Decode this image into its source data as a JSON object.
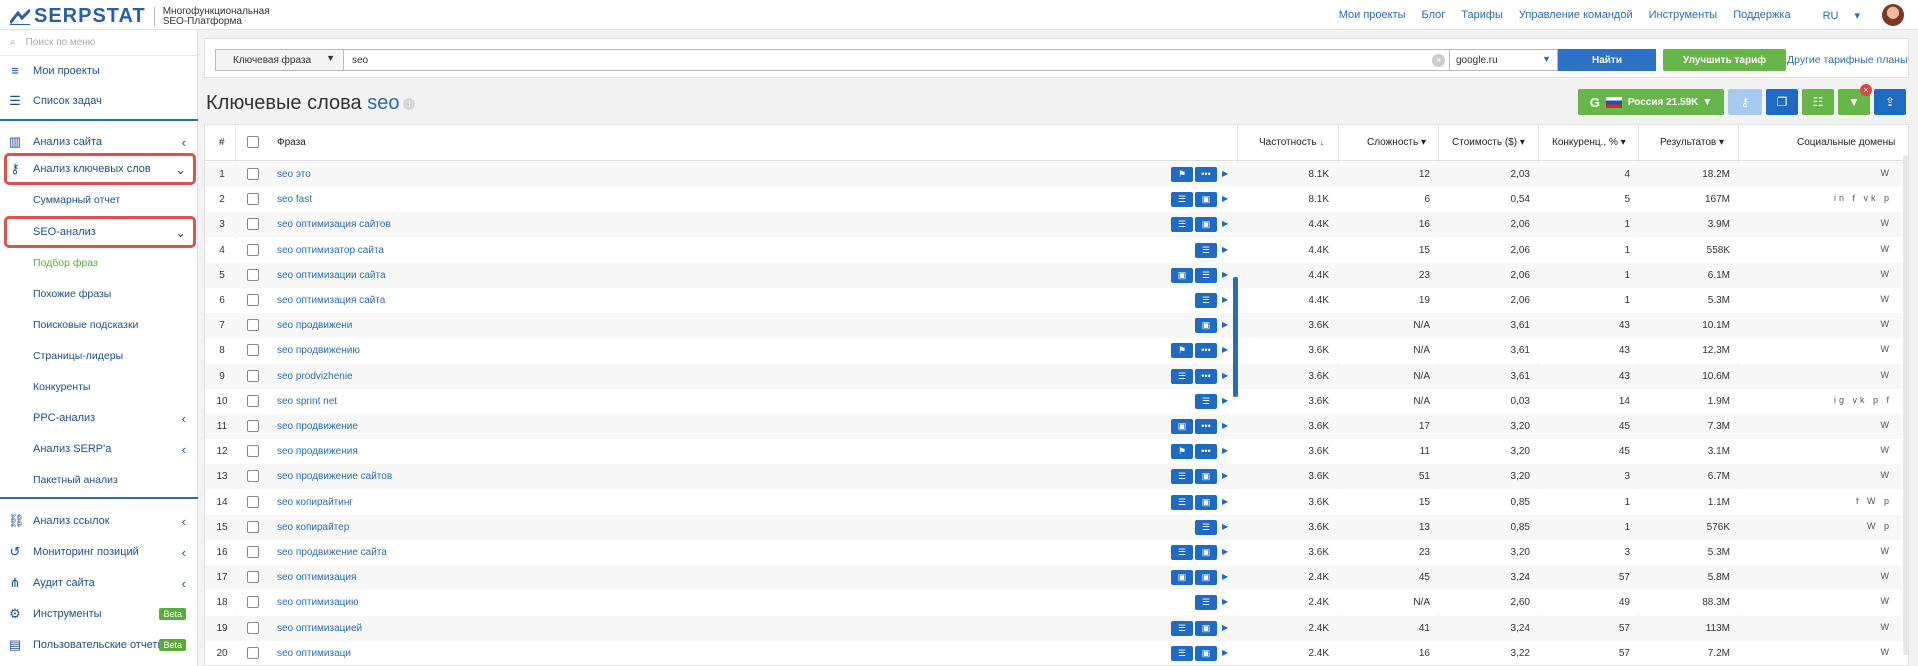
{
  "header": {
    "logo_text": "SERPSTAT",
    "logo_sub1": "Многофункциональная",
    "logo_sub2": "SEO-Платформа",
    "nav": [
      "Мои проекты",
      "Блог",
      "Тарифы",
      "Управление командой",
      "Инструменты",
      "Поддержка",
      "RU"
    ]
  },
  "sidebar": {
    "search_placeholder": "Поиск по меню",
    "top_items": [
      {
        "label": "Мои проекты",
        "icon": "menu-icon"
      },
      {
        "label": "Список задач",
        "icon": "list-icon"
      }
    ],
    "sections": [
      {
        "label": "Анализ сайта",
        "icon": "chart-icon"
      },
      {
        "label": "Анализ ключевых слов",
        "icon": "key-icon"
      },
      {
        "label": "SEO-анализ"
      },
      {
        "label": "PPC-анализ"
      },
      {
        "label": "Анализ SERP'а"
      },
      {
        "label": "Анализ ссылок",
        "icon": "link-icon"
      },
      {
        "label": "Мониторинг позиций",
        "icon": "history-icon"
      },
      {
        "label": "Аудит сайта",
        "icon": "sitemap-icon"
      },
      {
        "label": "Инструменты",
        "icon": "gear-icon",
        "badge": "Beta"
      },
      {
        "label": "Пользовательские отчеты",
        "icon": "report-icon",
        "badge": "Beta"
      }
    ],
    "sub_items": [
      "Суммарный отчет",
      "Подбор фраз",
      "Похожие фразы",
      "Поисковые подсказки",
      "Страницы-лидеры",
      "Конкуренты",
      "Пакетный анализ"
    ]
  },
  "search": {
    "type": "Ключевая фраза",
    "query": "seo",
    "database": "google.ru",
    "find": "Найти",
    "upgrade": "Улучшить тариф",
    "plans": "Другие тарифные планы"
  },
  "page": {
    "title": "Ключевые слова",
    "keyword": "seo",
    "region": "Россия 21.59K"
  },
  "table": {
    "headers": {
      "num": "#",
      "phrase": "Фраза",
      "freq": "Частотность",
      "diff": "Сложность",
      "cost": "Стоимость ($)",
      "comp": "Конкуренц., %",
      "res": "Результатов",
      "social": "Социальные домены"
    },
    "rows": [
      {
        "n": "1",
        "p": "seo это",
        "f": "8.1K",
        "d": "12",
        "c": "2,03",
        "k": "4",
        "r": "18.2M",
        "s": "W",
        "a": [
          "flag",
          "dots"
        ]
      },
      {
        "n": "2",
        "p": "seo fast",
        "f": "8.1K",
        "d": "6",
        "c": "0,54",
        "k": "5",
        "r": "167M",
        "s": "in f vk p",
        "a": [
          "chat",
          "img"
        ]
      },
      {
        "n": "3",
        "p": "seo оптимизация сайтов",
        "f": "4.4K",
        "d": "16",
        "c": "2,06",
        "k": "1",
        "r": "3.9M",
        "s": "W",
        "a": [
          "chat",
          "img"
        ]
      },
      {
        "n": "4",
        "p": "seo оптимизатор сайта",
        "f": "4.4K",
        "d": "15",
        "c": "2,06",
        "k": "1",
        "r": "558K",
        "s": "W",
        "a": [
          "chat"
        ]
      },
      {
        "n": "5",
        "p": "seo оптимизации сайта",
        "f": "4.4K",
        "d": "23",
        "c": "2,06",
        "k": "1",
        "r": "6.1M",
        "s": "W",
        "a": [
          "img",
          "chat"
        ]
      },
      {
        "n": "6",
        "p": "seo оптимизация сайта",
        "f": "4.4K",
        "d": "19",
        "c": "2,06",
        "k": "1",
        "r": "5.3M",
        "s": "W",
        "a": [
          "chat"
        ]
      },
      {
        "n": "7",
        "p": "seo продвижени",
        "f": "3.6K",
        "d": "N/A",
        "c": "3,61",
        "k": "43",
        "r": "10.1M",
        "s": "W",
        "a": [
          "img"
        ]
      },
      {
        "n": "8",
        "p": "seo продвижению",
        "f": "3.6K",
        "d": "N/A",
        "c": "3,61",
        "k": "43",
        "r": "12.3M",
        "s": "W",
        "a": [
          "flag",
          "dots"
        ]
      },
      {
        "n": "9",
        "p": "seo prodvizhenie",
        "f": "3.6K",
        "d": "N/A",
        "c": "3,61",
        "k": "43",
        "r": "10.6M",
        "s": "W",
        "a": [
          "chat",
          "dots"
        ]
      },
      {
        "n": "10",
        "p": "seo sprint net",
        "f": "3.6K",
        "d": "N/A",
        "c": "0,03",
        "k": "14",
        "r": "1.9M",
        "s": "ig vk p f",
        "a": [
          "chat"
        ]
      },
      {
        "n": "11",
        "p": "seo продвижение",
        "f": "3.6K",
        "d": "17",
        "c": "3,20",
        "k": "45",
        "r": "7.3M",
        "s": "W",
        "a": [
          "img",
          "dots"
        ]
      },
      {
        "n": "12",
        "p": "seo продвижения",
        "f": "3.6K",
        "d": "11",
        "c": "3,20",
        "k": "45",
        "r": "3.1M",
        "s": "W",
        "a": [
          "flag",
          "dots"
        ]
      },
      {
        "n": "13",
        "p": "seo продвижение сайтов",
        "f": "3.6K",
        "d": "51",
        "c": "3,20",
        "k": "3",
        "r": "6.7M",
        "s": "W",
        "a": [
          "chat",
          "img"
        ]
      },
      {
        "n": "14",
        "p": "seo копирайтинг",
        "f": "3.6K",
        "d": "15",
        "c": "0,85",
        "k": "1",
        "r": "1.1M",
        "s": "f W p",
        "a": [
          "chat",
          "img"
        ]
      },
      {
        "n": "15",
        "p": "seo копирайтер",
        "f": "3.6K",
        "d": "13",
        "c": "0,85",
        "k": "1",
        "r": "576K",
        "s": "W p",
        "a": [
          "chat"
        ]
      },
      {
        "n": "16",
        "p": "seo продвижение сайта",
        "f": "3.6K",
        "d": "23",
        "c": "3,20",
        "k": "3",
        "r": "5.3M",
        "s": "W",
        "a": [
          "chat",
          "img"
        ]
      },
      {
        "n": "17",
        "p": "seo оптимизация",
        "f": "2.4K",
        "d": "45",
        "c": "3,24",
        "k": "57",
        "r": "5.8M",
        "s": "W",
        "a": [
          "img",
          "img"
        ]
      },
      {
        "n": "18",
        "p": "seo оптимизацию",
        "f": "2.4K",
        "d": "N/A",
        "c": "2,60",
        "k": "49",
        "r": "88.3M",
        "s": "W",
        "a": [
          "chat"
        ]
      },
      {
        "n": "19",
        "p": "seo оптимизацией",
        "f": "2.4K",
        "d": "41",
        "c": "3,24",
        "k": "57",
        "r": "113M",
        "s": "W",
        "a": [
          "chat",
          "img"
        ]
      },
      {
        "n": "20",
        "p": "seo оптимизаци",
        "f": "2.4K",
        "d": "16",
        "c": "3,22",
        "k": "57",
        "r": "7.2M",
        "s": "W",
        "a": [
          "chat",
          "img"
        ]
      }
    ]
  },
  "colors": {
    "brand": "#2b5da8",
    "link": "#2b6cb0",
    "green": "#67b649",
    "highlight": "#d9534f"
  }
}
